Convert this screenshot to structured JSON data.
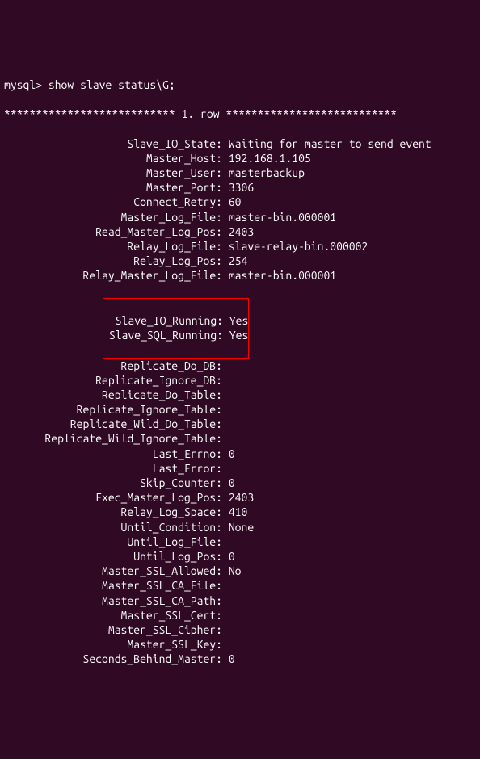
{
  "prompt": "mysql> show slave status\\G;",
  "row_separator": "*************************** 1. row ***************************",
  "fields": [
    {
      "key": "Slave_IO_State",
      "val": "Waiting for master to send event"
    },
    {
      "key": "Master_Host",
      "val": "192.168.1.105"
    },
    {
      "key": "Master_User",
      "val": "masterbackup"
    },
    {
      "key": "Master_Port",
      "val": "3306"
    },
    {
      "key": "Connect_Retry",
      "val": "60"
    },
    {
      "key": "Master_Log_File",
      "val": "master-bin.000001"
    },
    {
      "key": "Read_Master_Log_Pos",
      "val": "2403"
    },
    {
      "key": "Relay_Log_File",
      "val": "slave-relay-bin.000002"
    },
    {
      "key": "Relay_Log_Pos",
      "val": "254"
    },
    {
      "key": "Relay_Master_Log_File",
      "val": "master-bin.000001"
    }
  ],
  "highlight": [
    {
      "key": "Slave_IO_Running",
      "val": "Yes"
    },
    {
      "key": "Slave_SQL_Running",
      "val": "Yes"
    }
  ],
  "fields2": [
    {
      "key": "Replicate_Do_DB",
      "val": ""
    },
    {
      "key": "Replicate_Ignore_DB",
      "val": ""
    },
    {
      "key": "Replicate_Do_Table",
      "val": ""
    },
    {
      "key": "Replicate_Ignore_Table",
      "val": ""
    },
    {
      "key": "Replicate_Wild_Do_Table",
      "val": ""
    },
    {
      "key": "Replicate_Wild_Ignore_Table",
      "val": ""
    },
    {
      "key": "Last_Errno",
      "val": "0"
    },
    {
      "key": "Last_Error",
      "val": ""
    },
    {
      "key": "Skip_Counter",
      "val": "0"
    },
    {
      "key": "Exec_Master_Log_Pos",
      "val": "2403"
    },
    {
      "key": "Relay_Log_Space",
      "val": "410"
    },
    {
      "key": "Until_Condition",
      "val": "None"
    },
    {
      "key": "Until_Log_File",
      "val": ""
    },
    {
      "key": "Until_Log_Pos",
      "val": "0"
    },
    {
      "key": "Master_SSL_Allowed",
      "val": "No"
    },
    {
      "key": "Master_SSL_CA_File",
      "val": ""
    },
    {
      "key": "Master_SSL_CA_Path",
      "val": ""
    },
    {
      "key": "Master_SSL_Cert",
      "val": ""
    },
    {
      "key": "Master_SSL_Cipher",
      "val": ""
    },
    {
      "key": "Master_SSL_Key",
      "val": ""
    },
    {
      "key": "Seconds_Behind_Master",
      "val": "0"
    }
  ]
}
